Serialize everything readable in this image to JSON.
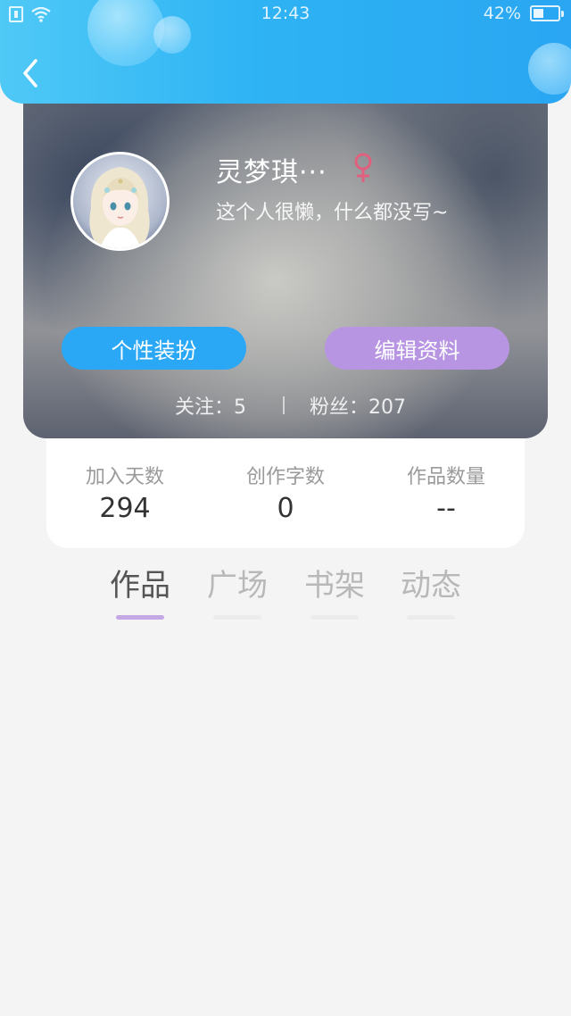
{
  "status_bar": {
    "time": "12:43",
    "battery_percent_text": "42%",
    "battery_level": 0.42
  },
  "profile": {
    "nickname": "灵梦琪···",
    "gender_symbol": "♀",
    "gender_color": "#e0607e",
    "bio": "这个人很懒，什么都没写~",
    "buttons": {
      "style_label": "个性装扮",
      "edit_label": "编辑资料"
    },
    "follow_label": "关注：5",
    "fans_label": "粉丝：207"
  },
  "stats": [
    {
      "label": "加入天数",
      "value": "294"
    },
    {
      "label": "创作字数",
      "value": "0"
    },
    {
      "label": "作品数量",
      "value": "--"
    }
  ],
  "tabs": [
    {
      "label": "作品",
      "active": true
    },
    {
      "label": "广场",
      "active": false
    },
    {
      "label": "书架",
      "active": false
    },
    {
      "label": "动态",
      "active": false
    }
  ],
  "colors": {
    "header_blue": "#2eb3f4",
    "button_blue": "#2aa7f5",
    "button_purple": "#b795e3",
    "tab_indicator": "#c4a8e6"
  },
  "icons": [
    "sim-card-icon",
    "wifi-icon",
    "battery-icon",
    "back-arrow-icon",
    "female-icon",
    "avatar-image"
  ]
}
